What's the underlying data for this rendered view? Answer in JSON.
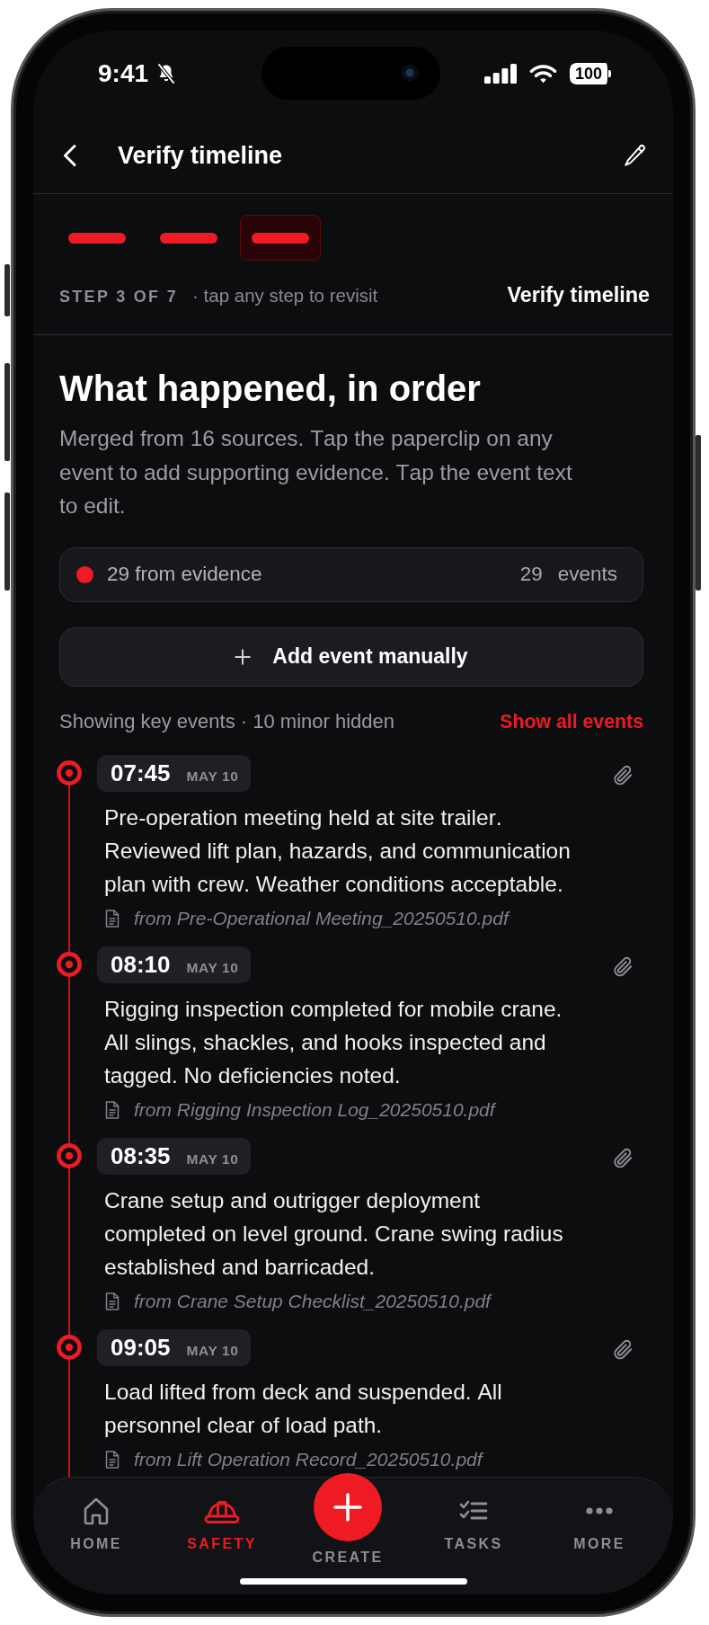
{
  "status_bar": {
    "time": "9:41",
    "battery": "100"
  },
  "header": {
    "title": "Verify timeline"
  },
  "steps": {
    "items": [
      {
        "selected": false
      },
      {
        "selected": false
      },
      {
        "selected": true
      }
    ],
    "counter": "STEP 3 OF 7",
    "hint": "· tap any step to revisit",
    "current": "Verify timeline"
  },
  "intro": {
    "title": "What happened, in order",
    "description": "Merged from 16 sources. Tap the paperclip on any event to add supporting evidence. Tap the event text to edit."
  },
  "summary": {
    "label": "29 from evidence",
    "count": "29",
    "unit": "events"
  },
  "add_button": {
    "label": "Add event manually"
  },
  "filter": {
    "status": "Showing key events · 10 minor hidden",
    "link": "Show all events"
  },
  "events": [
    {
      "time": "07:45",
      "date": "MAY 10",
      "text": "Pre-operation meeting held at site trailer. Reviewed lift plan, hazards, and communication plan with crew. Weather conditions acceptable.",
      "source": "from Pre-Operational Meeting_20250510.pdf"
    },
    {
      "time": "08:10",
      "date": "MAY 10",
      "text": "Rigging inspection completed for mobile crane. All slings, shackles, and hooks inspected and tagged. No deficiencies noted.",
      "source": "from Rigging Inspection Log_20250510.pdf"
    },
    {
      "time": "08:35",
      "date": "MAY 10",
      "text": "Crane setup and outrigger deployment completed on level ground. Crane swing radius established and barricaded.",
      "source": "from Crane Setup Checklist_20250510.pdf"
    },
    {
      "time": "09:05",
      "date": "MAY 10",
      "text": "Load lifted from deck and suspended. All personnel clear of load path.",
      "source": "from Lift Operation Record_20250510.pdf"
    }
  ],
  "nav": [
    {
      "kind": "tab",
      "label": "HOME",
      "selected": false
    },
    {
      "kind": "tab",
      "label": "SAFETY",
      "selected": true
    },
    {
      "kind": "action",
      "label": "CREATE",
      "selected": false
    },
    {
      "kind": "tab",
      "label": "TASKS",
      "selected": false
    },
    {
      "kind": "tab",
      "label": "MORE",
      "selected": false
    }
  ]
}
